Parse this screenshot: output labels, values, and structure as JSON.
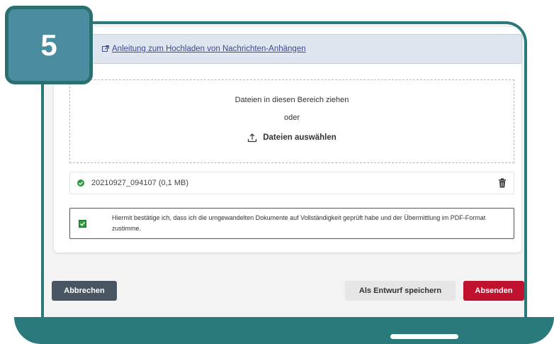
{
  "step_badge": "5",
  "guide_link": {
    "label": "Anleitung zum Hochladen von Nachrichten-Anhängen",
    "icon": "external-link-icon"
  },
  "dropzone": {
    "drag_text": "Dateien in diesen Bereich ziehen",
    "or_text": "oder",
    "select_label": "Dateien auswählen",
    "select_icon": "upload-icon"
  },
  "attachment": {
    "status_icon": "check-circle-icon",
    "name": "20210927_094107 (0,1 MB)",
    "delete_icon": "trash-icon"
  },
  "confirmation": {
    "checked": true,
    "text": "Hiermit bestätige ich, dass ich die umgewandelten Dokumente auf Vollständigkeit geprüft habe und der Übermittlung im PDF-Format zustimme."
  },
  "footer": {
    "cancel_label": "Abbrechen",
    "draft_label": "Als Entwurf speichern",
    "send_label": "Absenden"
  },
  "colors": {
    "frame": "#2a7a7c",
    "badge": "#4a8da0",
    "send": "#c0122e",
    "cancel": "#4a5563",
    "success": "#2e9a3e"
  }
}
